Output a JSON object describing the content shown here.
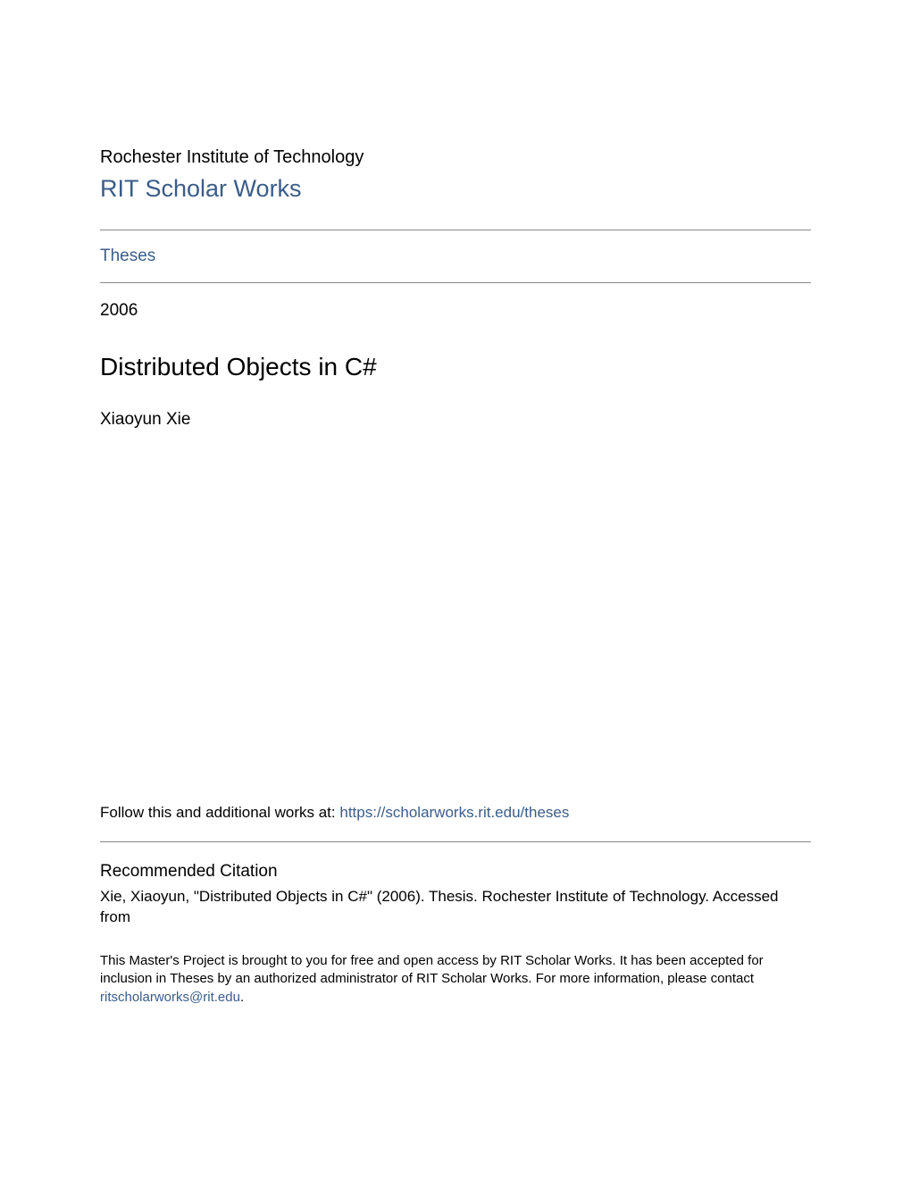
{
  "header": {
    "institution": "Rochester Institute of Technology",
    "repository": "RIT Scholar Works"
  },
  "collection": {
    "label": "Theses"
  },
  "metadata": {
    "year": "2006",
    "title": "Distributed Objects in C#",
    "author": "Xiaoyun Xie"
  },
  "follow": {
    "prefix": "Follow this and additional works at: ",
    "url": "https://scholarworks.rit.edu/theses"
  },
  "citation": {
    "heading": "Recommended Citation",
    "text": "Xie, Xiaoyun, \"Distributed Objects in C#\" (2006). Thesis. Rochester Institute of Technology. Accessed from"
  },
  "footer": {
    "text_before": "This Master's Project is brought to you for free and open access by RIT Scholar Works. It has been accepted for inclusion in Theses by an authorized administrator of RIT Scholar Works. For more information, please contact ",
    "email": "ritscholarworks@rit.edu",
    "text_after": "."
  }
}
